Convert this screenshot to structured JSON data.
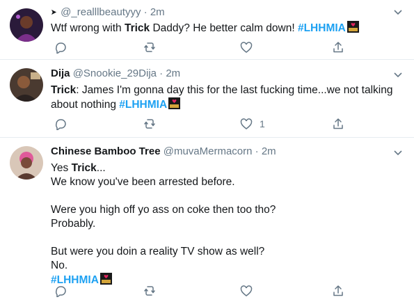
{
  "tweets": [
    {
      "display_name": "",
      "handle": "@_realllbeautyyy",
      "time": "2m",
      "lines": [
        [
          {
            "t": "Wtf wrong with "
          },
          {
            "t": "Trick",
            "kw": true
          },
          {
            "t": " Daddy? He better calm down! "
          },
          {
            "t": "#LHHMIA",
            "tag": true
          }
        ]
      ],
      "like_count": ""
    },
    {
      "display_name": "Dija",
      "handle": "@Snookie_29Dija",
      "time": "2m",
      "lines": [
        [
          {
            "t": "Trick",
            "kw": true
          },
          {
            "t": ": James I'm gonna day this for the last fucking time...we not talking"
          }
        ],
        [
          {
            "t": "about nothing "
          },
          {
            "t": "#LHHMIA",
            "tag": true
          }
        ]
      ],
      "like_count": "1"
    },
    {
      "display_name": "Chinese Bamboo Tree",
      "handle": "@muvaMermacorn",
      "time": "2m",
      "lines": [
        [
          {
            "t": "Yes "
          },
          {
            "t": "Trick",
            "kw": true
          },
          {
            "t": "..."
          }
        ],
        [
          {
            "t": "We know you've been arrested before."
          }
        ],
        [],
        [
          {
            "t": "Were you high off yo ass on coke then too tho?"
          }
        ],
        [
          {
            "t": "Probably."
          }
        ],
        [],
        [
          {
            "t": "But were you doin a reality TV show as well?"
          }
        ],
        [
          {
            "t": "No."
          }
        ],
        [
          {
            "t": "#LHHMIA",
            "tag": true
          }
        ]
      ],
      "like_count": ""
    }
  ],
  "colors": {
    "hashtag": "#1da1f2",
    "muted": "#657786",
    "divider": "#e6ecf0",
    "text": "#14171a"
  },
  "icons": {
    "reply": "reply-icon",
    "retweet": "retweet-icon",
    "like": "heart-icon",
    "share": "share-icon",
    "more": "chevron-down-icon",
    "emoji": "lhh-emoji-icon"
  }
}
